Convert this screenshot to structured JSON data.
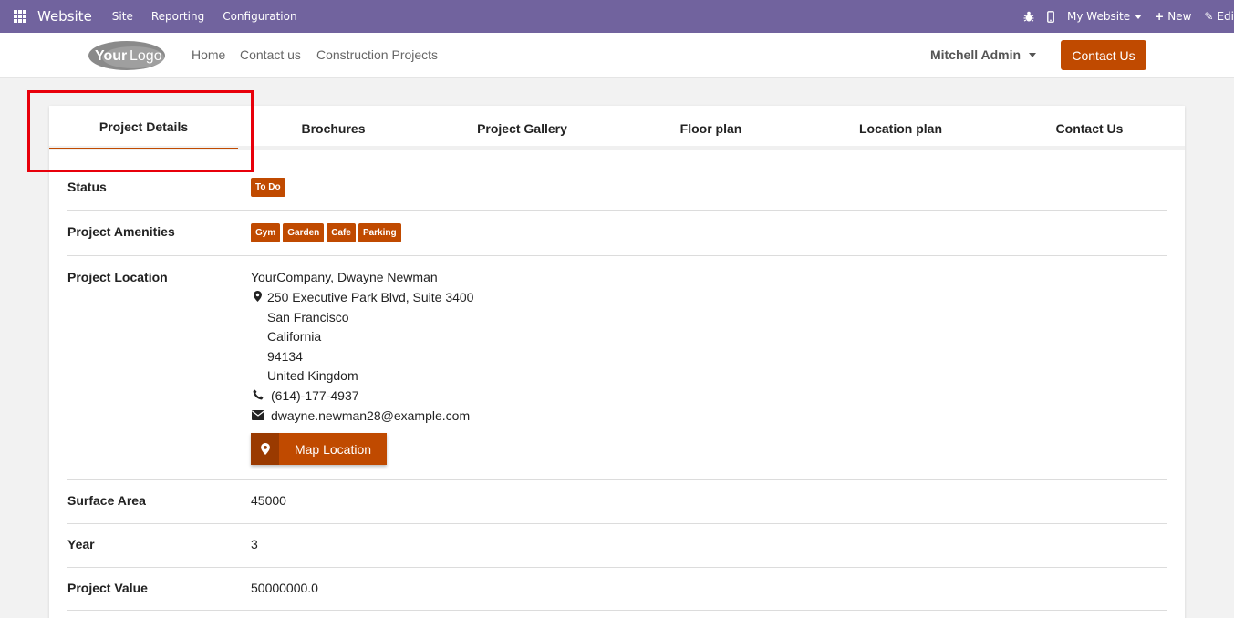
{
  "topbar": {
    "brand": "Website",
    "menus": [
      "Site",
      "Reporting",
      "Configuration"
    ],
    "website_selector": "My Website",
    "new_label": "New",
    "edit_label": "Edi"
  },
  "header": {
    "logo_text_a": "Your",
    "logo_text_b": "Logo",
    "nav": [
      "Home",
      "Contact us",
      "Construction Projects"
    ],
    "user": "Mitchell Admin",
    "cta": "Contact Us"
  },
  "tabs": [
    "Project Details",
    "Brochures",
    "Project Gallery",
    "Floor plan",
    "Location plan",
    "Contact Us"
  ],
  "details": {
    "status_label": "Status",
    "status_value": "To Do",
    "amenities_label": "Project Amenities",
    "amenities": [
      "Gym",
      "Garden",
      "Cafe",
      "Parking"
    ],
    "location_label": "Project Location",
    "location_name": "YourCompany, Dwayne Newman",
    "address": [
      "250 Executive Park Blvd, Suite 3400",
      "San Francisco",
      "California",
      "94134",
      "United Kingdom"
    ],
    "phone": "(614)-177-4937",
    "email": "dwayne.newman28@example.com",
    "map_button": "Map Location",
    "surface_label": "Surface Area",
    "surface_value": "45000",
    "year_label": "Year",
    "year_value": "3",
    "value_label": "Project Value",
    "value_value": "50000000.0"
  },
  "colors": {
    "topbar": "#71639e",
    "accent": "#c04a00",
    "highlight": "#e8000b"
  }
}
